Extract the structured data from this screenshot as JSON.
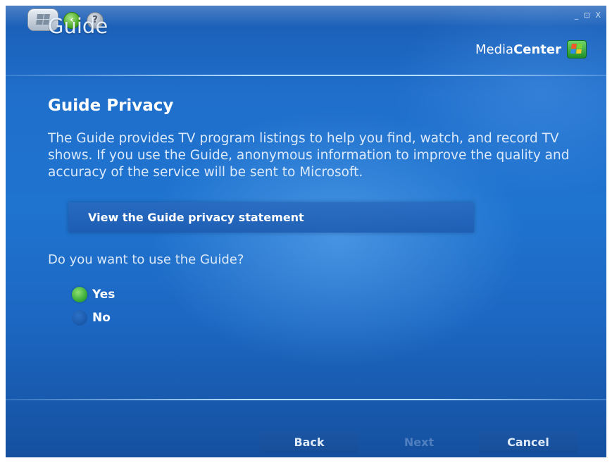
{
  "window": {
    "controls": "_ ⊡ X"
  },
  "header": {
    "section_title": "Guide",
    "brand": {
      "light": "Media",
      "bold": "Center"
    }
  },
  "main": {
    "heading": "Guide Privacy",
    "description": "The Guide provides TV program listings to help you find, watch, and record TV shows. If you use the Guide, anonymous information to improve the quality and accuracy of the service will be sent to Microsoft.",
    "privacy_link": "View the Guide privacy statement",
    "question": "Do you want to use the Guide?",
    "options": [
      {
        "label": "Yes",
        "selected": true
      },
      {
        "label": "No",
        "selected": false
      }
    ]
  },
  "footer": {
    "back": "Back",
    "next": "Next",
    "cancel": "Cancel"
  },
  "colors": {
    "background": "#1f6fcb",
    "selected_radio": "#2fa531"
  },
  "icons": [
    "start-button-icon",
    "back-arrow-icon",
    "help-icon",
    "media-center-logo-icon",
    "radio-selected-icon",
    "radio-unselected-icon"
  ]
}
